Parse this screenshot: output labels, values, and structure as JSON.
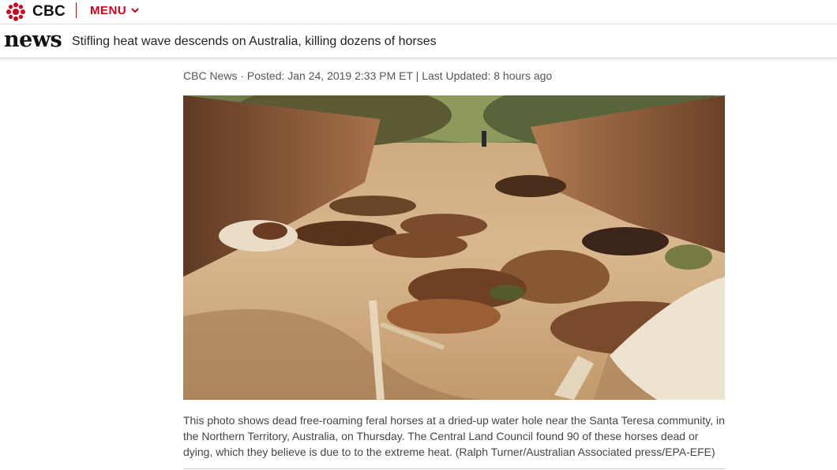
{
  "header": {
    "brand": "CBC",
    "menu_label": "MENU",
    "brand_color": "#d0021b"
  },
  "section": {
    "logo": "news",
    "headline": "Stifling heat wave descends on Australia, killing dozens of horses"
  },
  "article": {
    "byline": "CBC News · Posted: Jan 24, 2019 2:33 PM ET | Last Updated: 8 hours ago",
    "photo_alt": "Dead feral horses in a dried-up water hole",
    "caption": "This photo shows dead free-roaming feral horses at a dried-up water hole near the Santa Teresa community, in the Northern Territory, Australia, on Thursday. The Central Land Council found 90 of these horses dead or dying, which they believe is due to to the extreme heat. (Ralph Turner/Australian Associated press/EPA-EFE)"
  },
  "icons": {
    "logo": "cbc-gem-icon",
    "menu": "chevron-down-icon"
  }
}
